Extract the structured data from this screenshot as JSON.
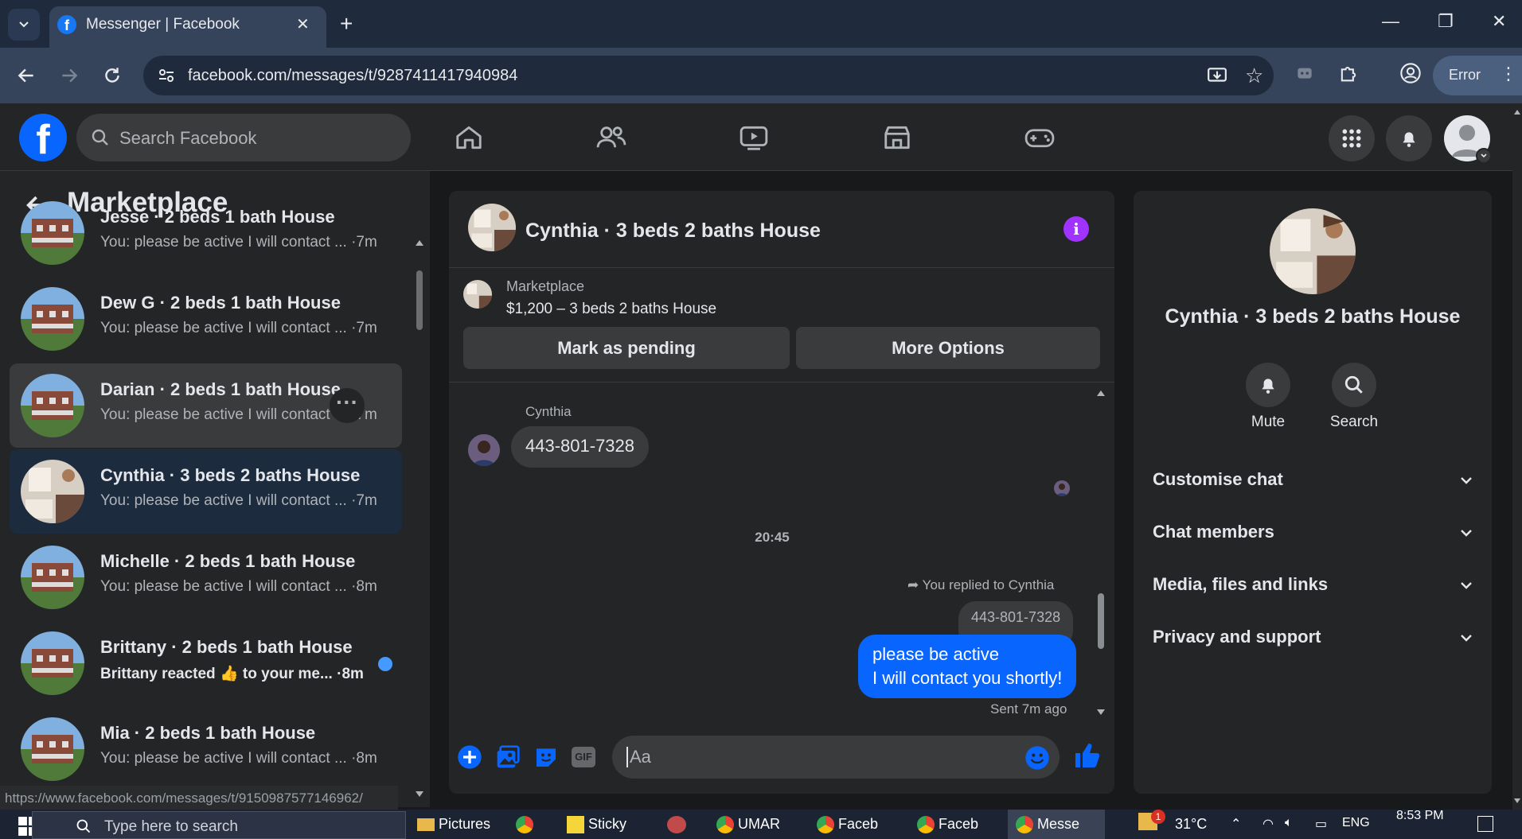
{
  "browser": {
    "tab_title": "Messenger | Facebook",
    "url": "facebook.com/messages/t/9287411417940984",
    "profile_status": "Error",
    "status_url": "https://www.facebook.com/messages/t/9150987577146962/"
  },
  "header": {
    "search_placeholder": "Search Facebook"
  },
  "sidebar": {
    "title": "Marketplace",
    "conversations": [
      {
        "name": "Jesse · 2 beds 1 bath House",
        "snippet": "You: please be active I will contact ... ·7m"
      },
      {
        "name": "Dew G · 2 beds 1 bath House",
        "snippet": "You: please be active I will contact ... ·7m"
      },
      {
        "name": "Darian · 2 beds 1 bath House",
        "snippet": "You: please be active I will contact ... ·7m"
      },
      {
        "name": "Cynthia · 3 beds 2 baths House",
        "snippet": "You: please be active I will contact ... ·7m"
      },
      {
        "name": "Michelle · 2 beds 1 bath House",
        "snippet": "You: please be active I will contact ... ·8m"
      },
      {
        "name": "Brittany · 2 beds 1 bath House",
        "snippet": "Brittany reacted 👍 to your me... ·8m"
      },
      {
        "name": "Mia · 2 beds 1 bath House",
        "snippet": "You: please be active I will contact ... ·8m"
      }
    ]
  },
  "chat": {
    "title": "Cynthia · 3 beds 2 baths House",
    "listing_source": "Marketplace",
    "listing_price": "$1,200 – 3 beds 2 baths House",
    "mark_pending_label": "Mark as pending",
    "more_options_label": "More Options",
    "incoming_sender": "Cynthia",
    "incoming_message": "443-801-7328",
    "time_divider": "20:45",
    "reply_context": "You replied to Cynthia",
    "quoted_message": "443-801-7328",
    "outgoing_line1": "please be active",
    "outgoing_line2": "I will contact you shortly!",
    "sent_status": "Sent 7m ago",
    "composer_placeholder": "Aa"
  },
  "details": {
    "title": "Cynthia · 3 beds 2 baths House",
    "mute_label": "Mute",
    "search_label": "Search",
    "sections": [
      "Customise chat",
      "Chat members",
      "Media, files and links",
      "Privacy and support"
    ]
  },
  "taskbar": {
    "search_placeholder": "Type here to search",
    "items": [
      "Pictures",
      "Sticky",
      "UMAR",
      "Faceb",
      "Faceb",
      "Messe"
    ],
    "temperature": "31°C",
    "language": "ENG",
    "time": "8:53 PM",
    "notification_count": "1"
  },
  "colors": {
    "fb_blue": "#0866ff",
    "panel_bg": "#242526",
    "page_bg": "#18191a",
    "selected_row": "#1c2b3e",
    "hover_row": "#3a3b3c",
    "info_purple": "#a033ff"
  }
}
